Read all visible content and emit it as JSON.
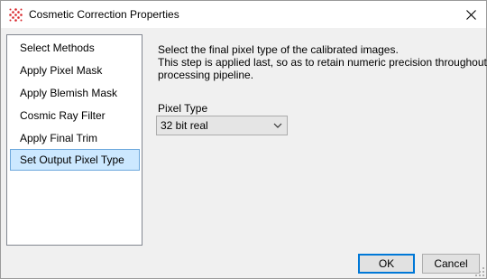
{
  "window": {
    "title": "Cosmetic Correction Properties",
    "icons": {
      "app": "grid-app-icon",
      "close": "close-icon"
    }
  },
  "sidebar": {
    "items": [
      {
        "label": "Select Methods",
        "selected": false
      },
      {
        "label": "Apply Pixel Mask",
        "selected": false
      },
      {
        "label": "Apply Blemish Mask",
        "selected": false
      },
      {
        "label": "Cosmic Ray Filter",
        "selected": false
      },
      {
        "label": "Apply Final Trim",
        "selected": false
      },
      {
        "label": "Set Output Pixel Type",
        "selected": true
      }
    ],
    "colors": {
      "selected_bg": "#cce8ff",
      "selected_border": "#6da8dc"
    }
  },
  "main": {
    "description_lines": [
      "Select the final pixel type of the calibrated images.",
      "This step is applied last, so as to retain numeric precision throughout the",
      "processing pipeline."
    ],
    "pixel_type": {
      "label": "Pixel Type",
      "selected_value": "32 bit real"
    }
  },
  "footer": {
    "ok_label": "OK",
    "cancel_label": "Cancel",
    "colors": {
      "default_button_border": "#0078d7"
    }
  }
}
